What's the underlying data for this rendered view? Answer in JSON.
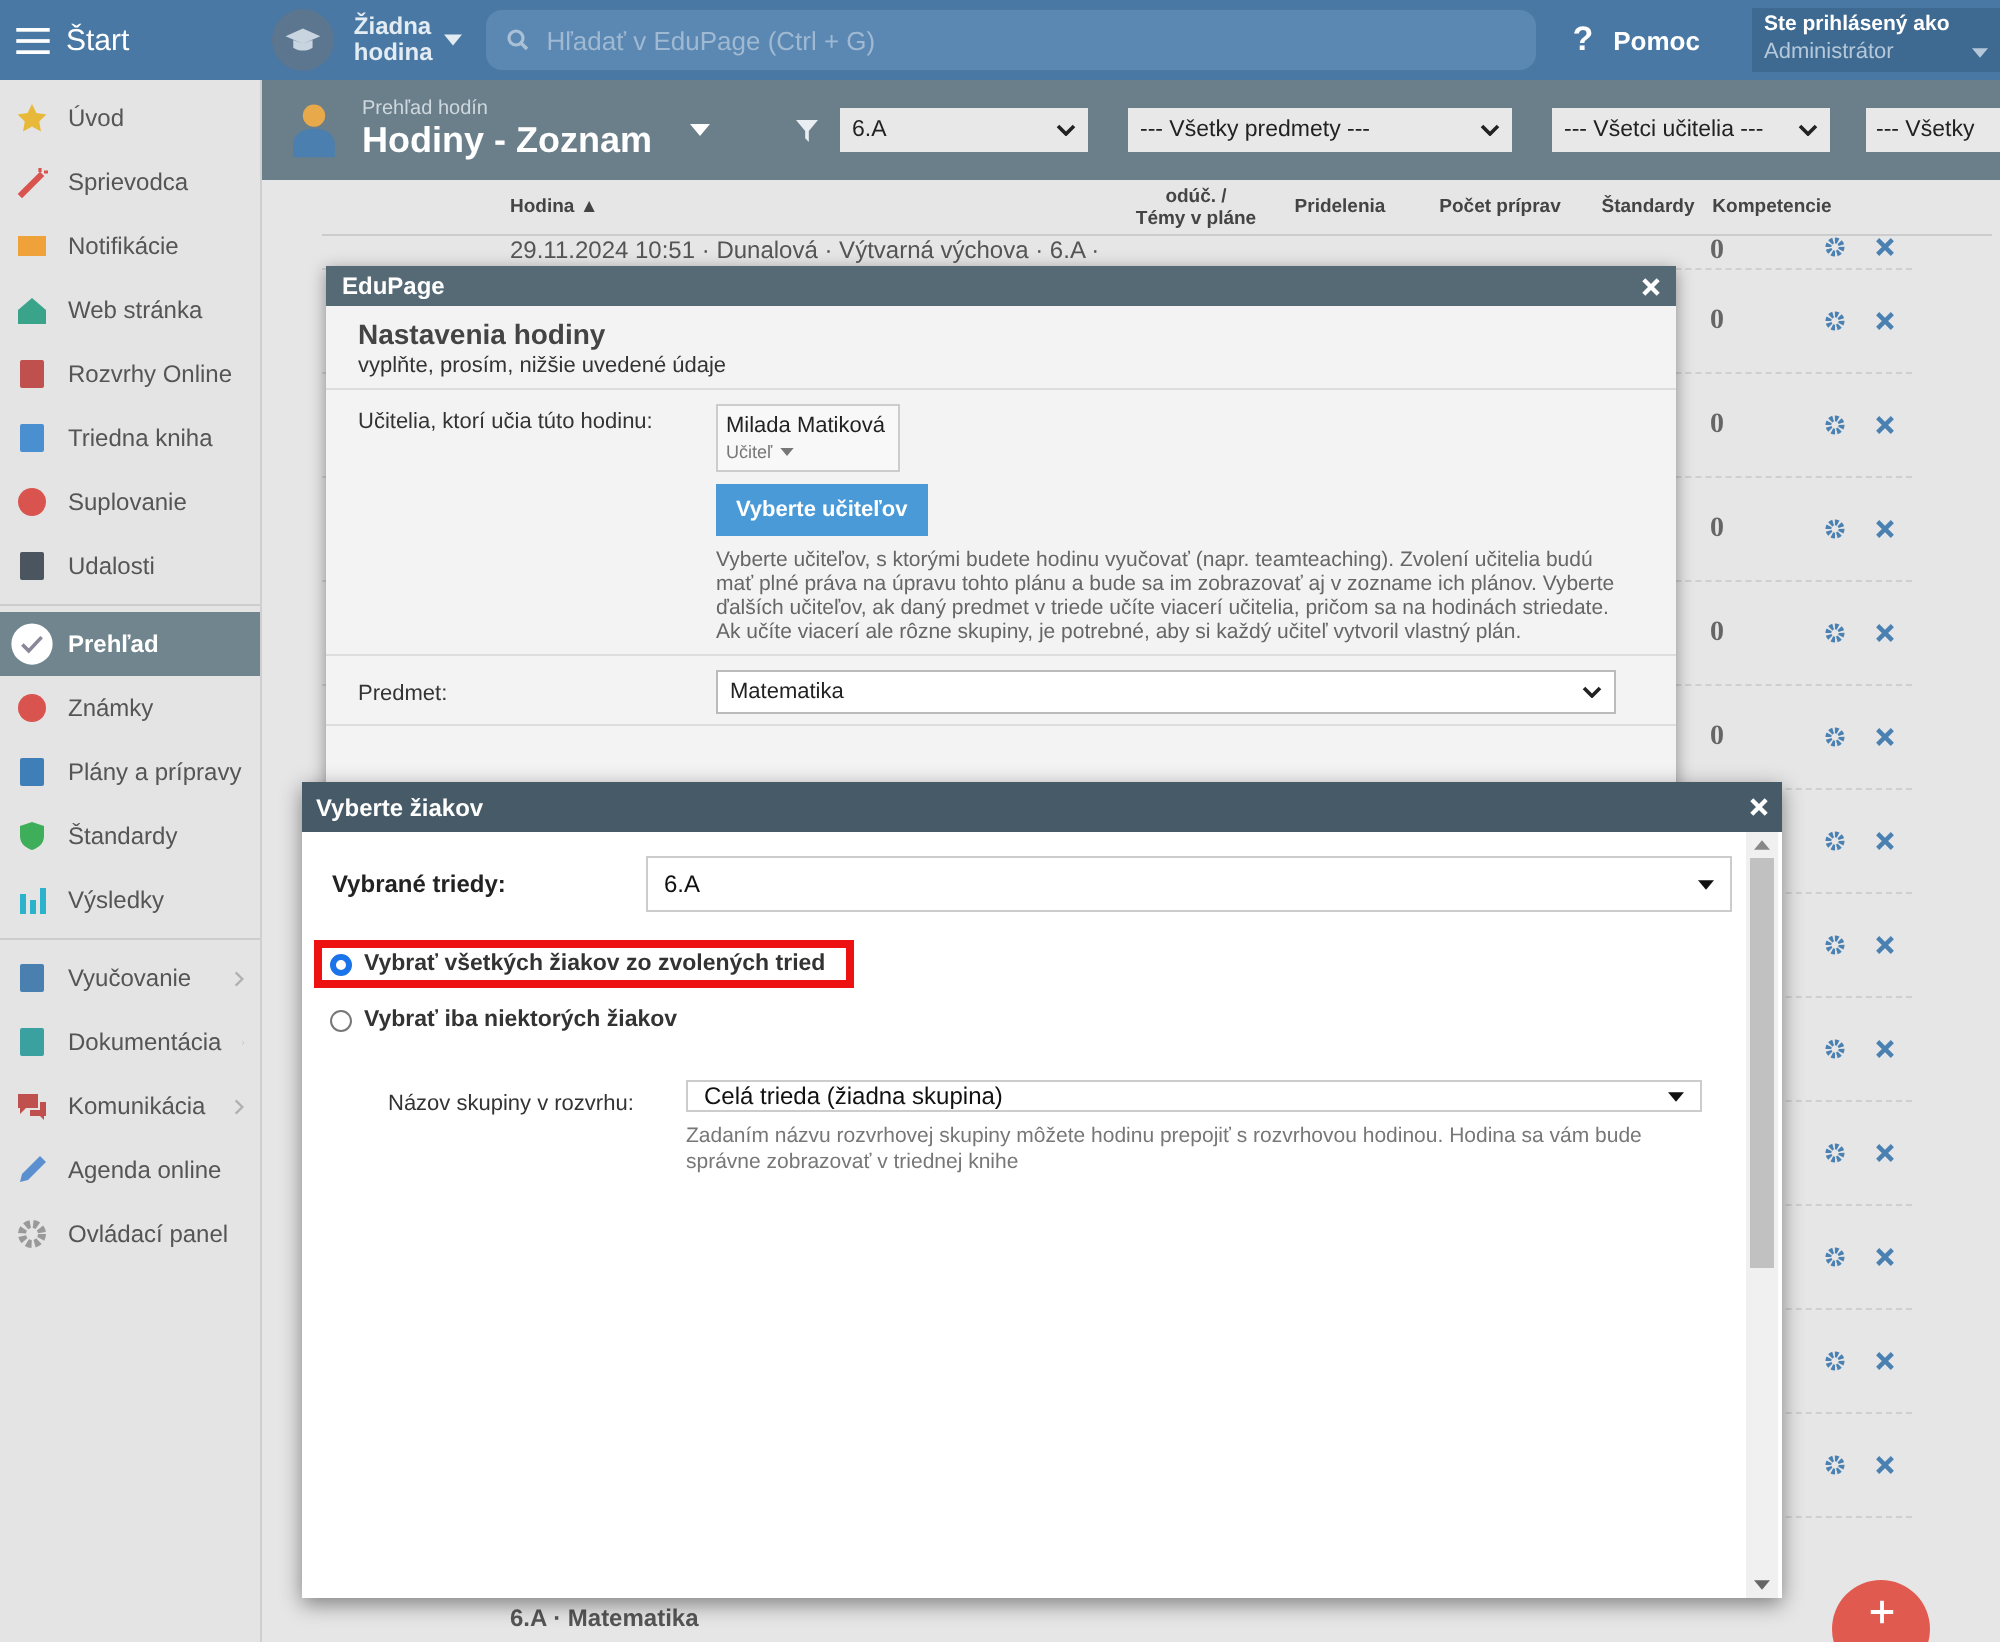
{
  "topbar": {
    "menu_label": "Štart",
    "lesson": [
      "Žiadna",
      "hodina"
    ],
    "search": {
      "placeholder": "Hľadať v EduPage (Ctrl + G)"
    },
    "help_icon": "?",
    "help": "Pomoc",
    "user": {
      "title": "Ste prihlásený ako",
      "role": "Administrátor"
    }
  },
  "sidebar": {
    "groups": [
      [
        {
          "label": "Úvod",
          "selected": false,
          "expandable": false
        },
        {
          "label": "Sprievodca",
          "selected": false,
          "expandable": false
        },
        {
          "label": "Notifikácie",
          "selected": false,
          "expandable": false
        },
        {
          "label": "Web stránka",
          "selected": false,
          "expandable": false
        },
        {
          "label": "Rozvrhy Online",
          "selected": false,
          "expandable": false
        },
        {
          "label": "Triedna kniha",
          "selected": false,
          "expandable": false
        },
        {
          "label": "Suplovanie",
          "selected": false,
          "expandable": false
        },
        {
          "label": "Udalosti",
          "selected": false,
          "expandable": false
        }
      ],
      [
        {
          "label": "Prehľad",
          "selected": true,
          "expandable": false
        },
        {
          "label": "Známky",
          "selected": false,
          "expandable": false
        },
        {
          "label": "Plány a prípravy",
          "selected": false,
          "expandable": false
        },
        {
          "label": "Štandardy",
          "selected": false,
          "expandable": false
        },
        {
          "label": "Výsledky",
          "selected": false,
          "expandable": false
        }
      ],
      [
        {
          "label": "Vyučovanie",
          "selected": false,
          "expandable": true
        },
        {
          "label": "Dokumentácia",
          "selected": false,
          "expandable": true
        },
        {
          "label": "Komunikácia",
          "selected": false,
          "expandable": true
        },
        {
          "label": "Agenda online",
          "selected": false,
          "expandable": false
        },
        {
          "label": "Ovládací panel",
          "selected": false,
          "expandable": false
        }
      ]
    ]
  },
  "header": {
    "subtitle": "Prehľad hodín",
    "title": "Hodiny - Zoznam",
    "filters": [
      "6.A",
      "--- Všetky predmety ---",
      "--- Všetci učitelia ---",
      "--- Všetky"
    ]
  },
  "table": {
    "columns": [
      "Hodina ▲",
      "odúč. /\nTémy v pláne",
      "Pridelenia",
      "Počet príprav",
      "Štandardy",
      "Kompetencie"
    ],
    "rows": [
      {
        "title": "29.11.2024 10:51 · Dunalová · Výtvarná výchova · 6.A ·",
        "value": "0"
      },
      {
        "value": "0"
      },
      {
        "value": "0"
      },
      {
        "value": "0"
      },
      {
        "value": "0"
      },
      {
        "value": "0"
      },
      {
        "value": ""
      },
      {
        "value": ""
      },
      {
        "value": ""
      },
      {
        "value": ""
      },
      {
        "value": ""
      },
      {
        "value": ""
      },
      {
        "value": ""
      },
      {
        "title": "6.A · Matematika",
        "value": ""
      }
    ]
  },
  "dialog_lesson": {
    "title": "EduPage",
    "heading": "Nastavenia hodiny",
    "subheading": "vyplňte, prosím, nižšie uvedené údaje",
    "teachers_label": "Učitelia, ktorí učia túto hodinu:",
    "teacher": {
      "name": "Milada Matiková",
      "role": "Učiteľ"
    },
    "teachers_button": "Vyberte učiteľov",
    "teachers_help": "Vyberte učiteľov, s ktorými budete hodinu vyučovať (napr. teamteaching). Zvolení učitelia budú mať plné práva na úpravu tohto plánu a bude sa im zobrazovať aj v zozname ich plánov. Vyberte ďalších učiteľov, ak daný predmet v triede učíte viacerí učitelia, pričom sa na hodinách striedate. Ak učíte viacerí ale rôzne skupiny, je potrebné, aby si každý učiteľ vytvoril vlastný plán.",
    "subject_label": "Predmet:",
    "subject": "Matematika"
  },
  "dialog_students": {
    "title": "Vyberte žiakov",
    "classes_label": "Vybrané triedy:",
    "classes": "6.A",
    "options": [
      {
        "label": "Vybrať všetkých žiakov zo zvolených tried",
        "selected": true,
        "highlighted": true
      },
      {
        "label": "Vybrať iba niektorých žiakov",
        "selected": false,
        "highlighted": false
      }
    ],
    "group_label": "Názov skupiny v rozvrhu:",
    "group": "Celá trieda (žiadna skupina)",
    "group_help": "Zadaním názvu rozvrhovej skupiny môžete hodinu prepojiť s rozvrhovou hodinou. Hodina sa vám bude správne zobrazovať v triednej knihe"
  }
}
